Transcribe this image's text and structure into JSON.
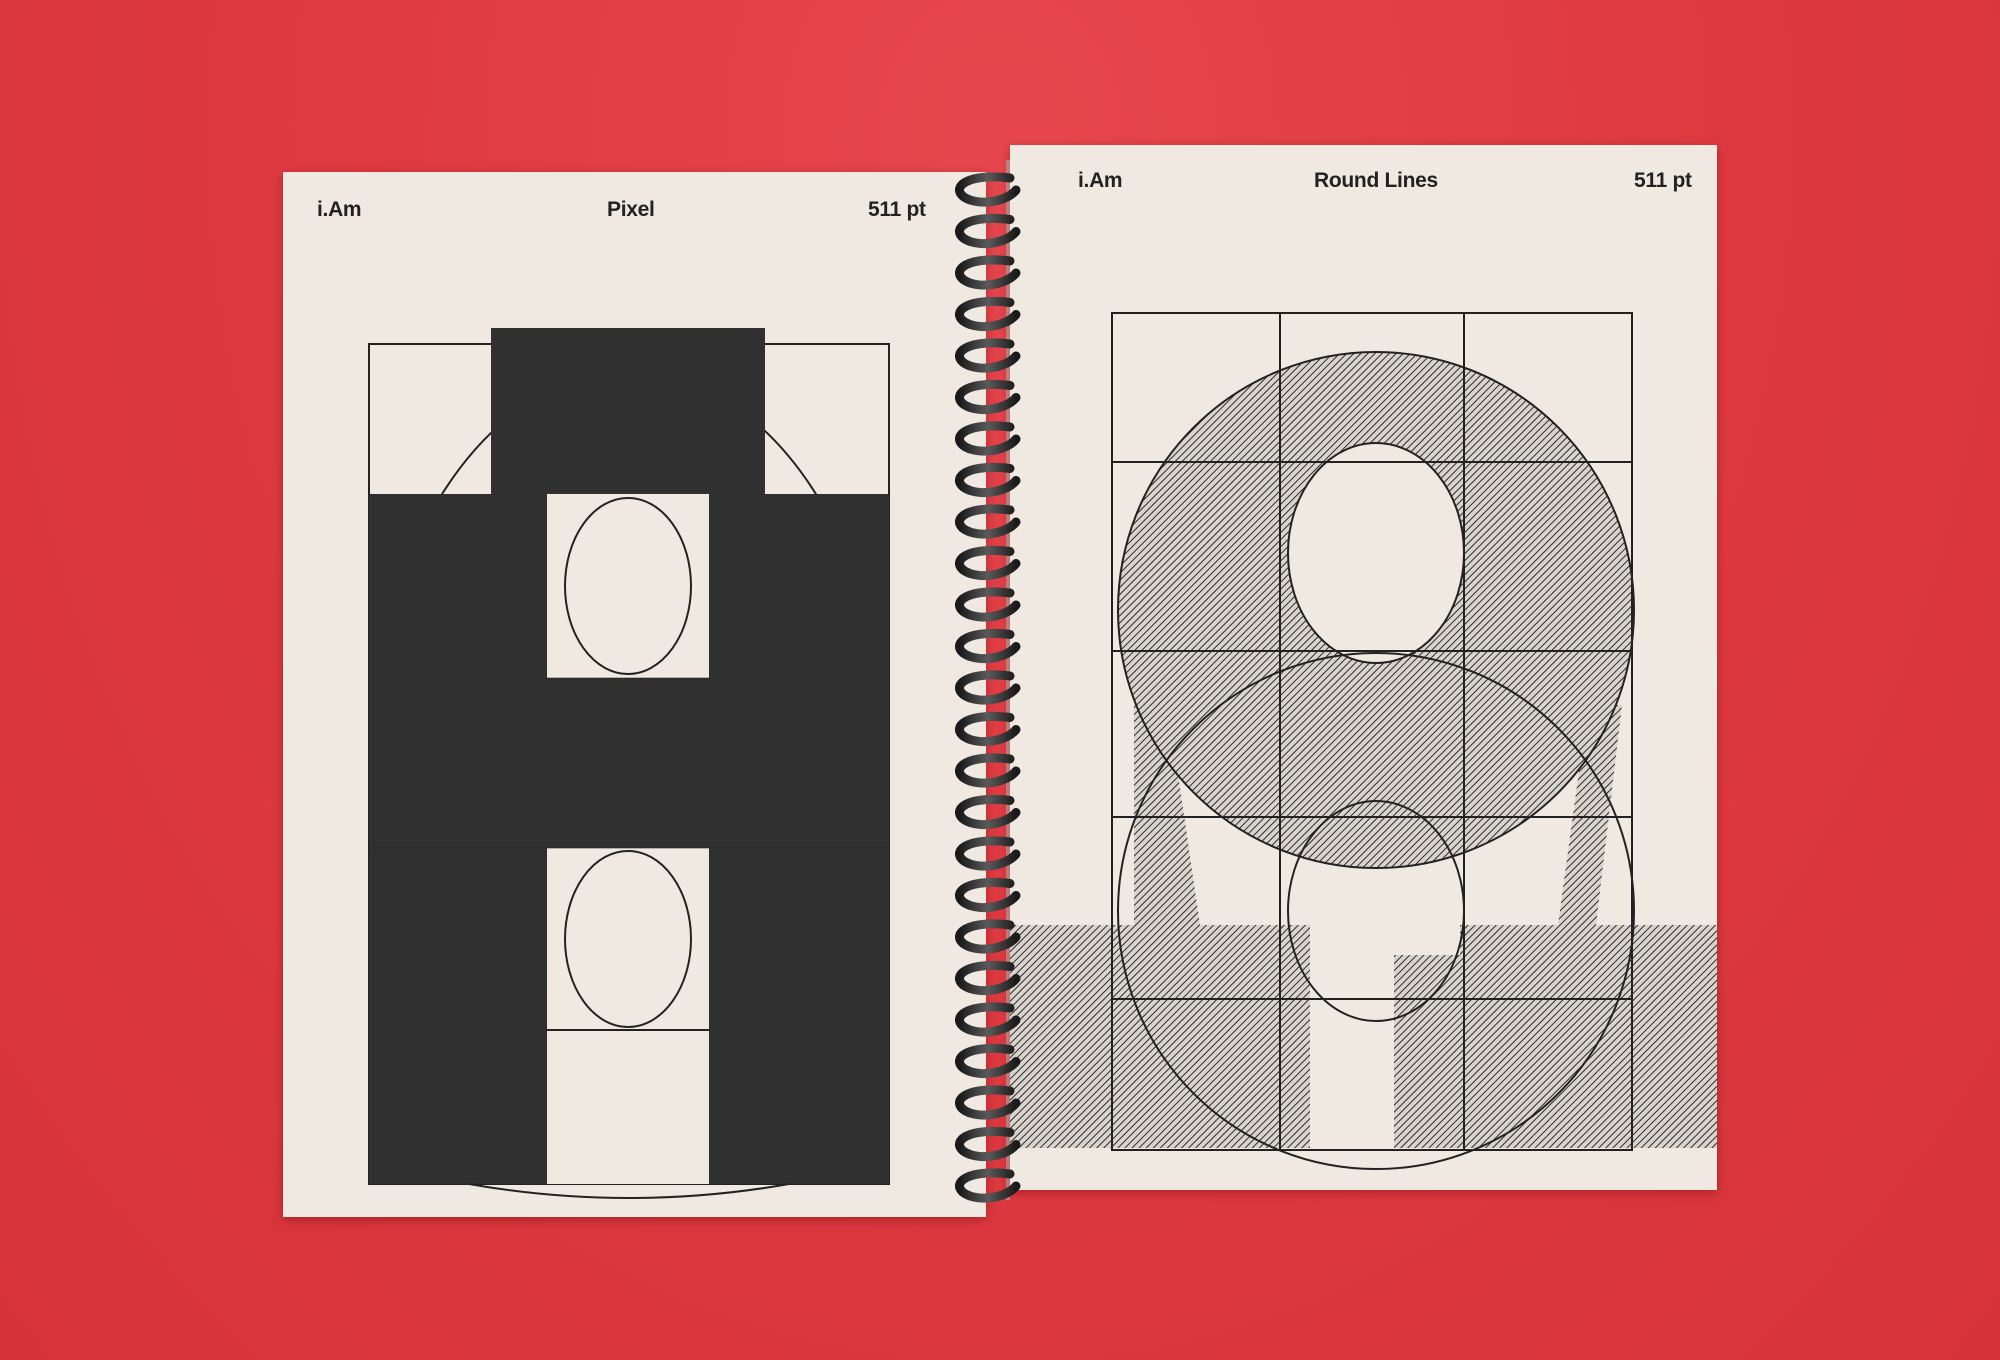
{
  "left_page": {
    "header_left": "i.Am",
    "header_center": "Pixel",
    "header_right": "511 pt"
  },
  "right_page": {
    "header_left": "i.Am",
    "header_center": "Round Lines",
    "header_right": "511 pt"
  },
  "colors": {
    "background_red": "#df3a41",
    "paper": "#efe9e2",
    "ink": "#2c2c2c"
  }
}
